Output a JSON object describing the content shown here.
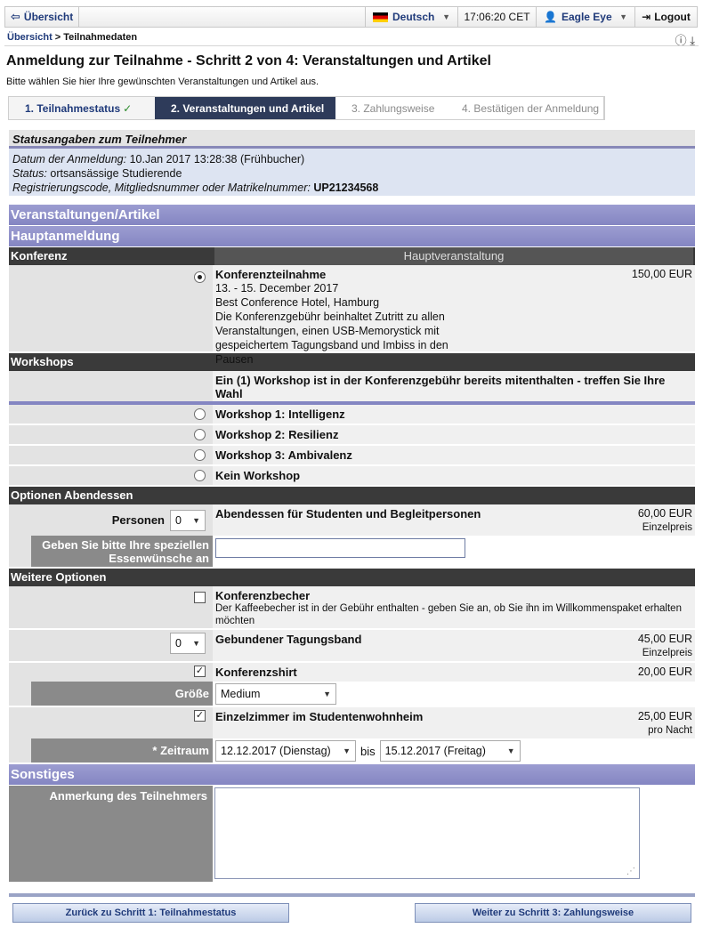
{
  "topbar": {
    "home_label": "Übersicht",
    "language": "Deutsch",
    "time": "17:06:20 CET",
    "user": "Eagle Eye",
    "logout_label": "Logout"
  },
  "breadcrumb": {
    "root": "Übersicht",
    "separator": ">",
    "current": "Teilnahmedaten"
  },
  "page": {
    "title": "Anmeldung zur Teilnahme - Schritt 2 von 4: Veranstaltungen und Artikel",
    "subtitle": "Bitte wählen Sie hier Ihre gewünschten Veranstaltungen und Artikel aus."
  },
  "steps": [
    {
      "label": "1. Teilnahmestatus",
      "state": "done"
    },
    {
      "label": "2. Veranstaltungen und Artikel",
      "state": "active"
    },
    {
      "label": "3. Zahlungsweise",
      "state": "todo"
    },
    {
      "label": "4. Bestätigen der Anmeldung",
      "state": "todo"
    }
  ],
  "status": {
    "heading": "Statusangaben zum Teilnehmer",
    "date_label": "Datum der Anmeldung:",
    "date_value": "10.Jan 2017 13:28:38 (Frühbucher)",
    "status_label": "Status:",
    "status_value": "ortsansässige Studierende",
    "code_label": "Registrierungscode, Mitgliedsnummer oder Matrikelnummer:",
    "code_value": "UP21234568"
  },
  "sections": {
    "events": "Veranstaltungen/Artikel",
    "main_registration": "Hauptanmeldung",
    "other": "Sonstiges"
  },
  "conference": {
    "group_label": "Konferenz",
    "group_right": "Hauptveranstaltung",
    "title": "Konferenzteilnahme",
    "dates": "13. - 15. December 2017",
    "venue": "Best Conference Hotel, Hamburg",
    "description": "Die Konferenzgebühr beinhaltet Zutritt zu allen Veranstaltungen, einen USB-Memorystick mit gespeichertem Tagungsband und Imbiss in den Pausen",
    "price": "150,00 EUR"
  },
  "workshops": {
    "group_label": "Workshops",
    "notice": "Ein (1) Workshop ist in der Konferenzgebühr bereits mitenthalten - treffen Sie Ihre Wahl",
    "options": [
      "Workshop 1: Intelligenz",
      "Workshop 2: Resilienz",
      "Workshop 3: Ambivalenz",
      "Kein Workshop"
    ]
  },
  "dinner": {
    "group_label": "Optionen Abendessen",
    "persons_label": "Personen",
    "persons_value": "0",
    "title": "Abendessen für Studenten und Begleitpersonen",
    "price": "60,00 EUR",
    "price_unit": "Einzelpreis",
    "wishes_label": "Geben Sie bitte Ihre speziellen Essenwünsche an",
    "wishes_value": ""
  },
  "more": {
    "group_label": "Weitere Optionen",
    "mug_title": "Konferenzbecher",
    "mug_desc": "Der Kaffeebecher ist in der Gebühr enthalten - geben Sie an, ob Sie ihn im Willkommenspaket erhalten möchten",
    "mug_checked": false,
    "book_qty": "0",
    "book_title": "Gebundener Tagungsband",
    "book_price": "45,00 EUR",
    "book_unit": "Einzelpreis",
    "shirt_title": "Konferenzshirt",
    "shirt_checked": true,
    "shirt_price": "20,00 EUR",
    "size_label": "Größe",
    "size_value": "Medium",
    "room_title": "Einzelzimmer im Studentenwohnheim",
    "room_checked": true,
    "room_price": "25,00 EUR",
    "room_unit": "pro Nacht",
    "period_label": "* Zeitraum",
    "period_from": "12.12.2017 (Dienstag)",
    "period_sep": "bis",
    "period_to": "15.12.2017 (Freitag)"
  },
  "other": {
    "remark_label": "Anmerkung des Teilnehmers",
    "remark_value": ""
  },
  "buttons": {
    "back": "Zurück zu Schritt 1: Teilnahmestatus",
    "next": "Weiter zu Schritt 3: Zahlungsweise"
  }
}
